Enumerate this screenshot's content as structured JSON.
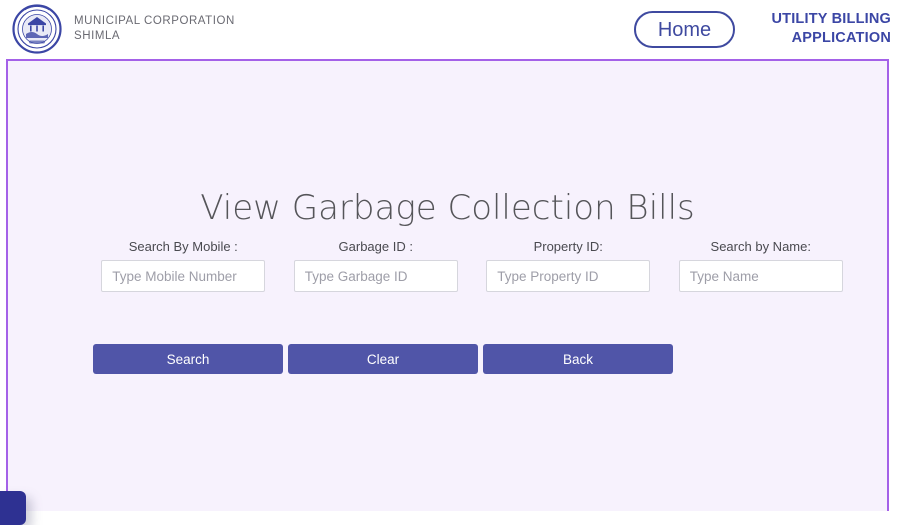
{
  "header": {
    "logo_alt": "Municipal Corporation Shimla seal",
    "brand_line1": "MUNICIPAL CORPORATION",
    "brand_line2": "SHIMLA",
    "home_label": "Home",
    "app_title_line1": "UTILITY BILLING",
    "app_title_line2": "APPLICATION"
  },
  "main": {
    "page_title": "View Garbage Collection Bills",
    "fields": [
      {
        "label": "Search By Mobile :",
        "placeholder": "Type Mobile Number",
        "value": ""
      },
      {
        "label": "Garbage ID :",
        "placeholder": "Type Garbage ID",
        "value": ""
      },
      {
        "label": "Property ID:",
        "placeholder": "Type Property ID",
        "value": ""
      },
      {
        "label": "Search by Name:",
        "placeholder": "Type Name",
        "value": ""
      }
    ],
    "buttons": [
      {
        "label": "Search"
      },
      {
        "label": "Clear"
      },
      {
        "label": "Back"
      }
    ]
  },
  "colors": {
    "panel_background": "#f7f2fd",
    "panel_border": "#a461e8",
    "button_background": "#5055a8",
    "brand_accent": "#3b46a5",
    "title_text": "#555559"
  }
}
